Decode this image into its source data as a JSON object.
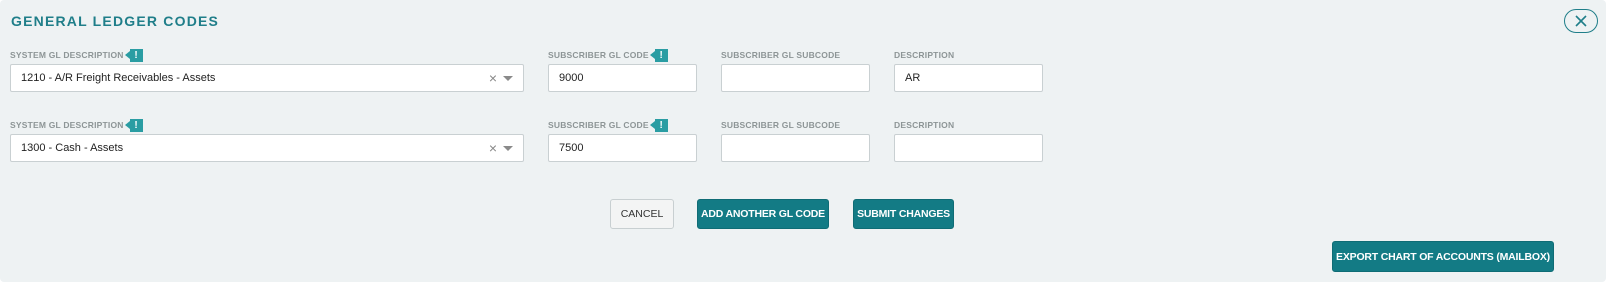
{
  "header": {
    "title": "GENERAL LEDGER CODES"
  },
  "rows": [
    {
      "system_label": "SYSTEM GL DESCRIPTION",
      "system_value": "1210 - A/R Freight Receivables - Assets",
      "code_label": "SUBSCRIBER GL CODE",
      "code_value": "9000",
      "subcode_label": "SUBSCRIBER GL SUBCODE",
      "subcode_value": "",
      "desc_label": "DESCRIPTION",
      "desc_value": "AR"
    },
    {
      "system_label": "SYSTEM GL DESCRIPTION",
      "system_value": "1300 - Cash - Assets",
      "code_label": "SUBSCRIBER GL CODE",
      "code_value": "7500",
      "subcode_label": "SUBSCRIBER GL SUBCODE",
      "subcode_value": "",
      "desc_label": "DESCRIPTION",
      "desc_value": ""
    }
  ],
  "info_glyph": "!",
  "clear_glyph": "×",
  "icons": [
    "close-icon",
    "info-icon",
    "clear-icon",
    "chevron-down-icon"
  ],
  "actions": {
    "cancel": "CANCEL",
    "add": "ADD ANOTHER GL CODE",
    "submit": "SUBMIT CHANGES",
    "export": "EXPORT CHART OF ACCOUNTS (MAILBOX)"
  },
  "colors": {
    "accent": "#1f7e89",
    "button": "#137b85",
    "panel": "#eef2f3",
    "info": "#2a9da3"
  }
}
